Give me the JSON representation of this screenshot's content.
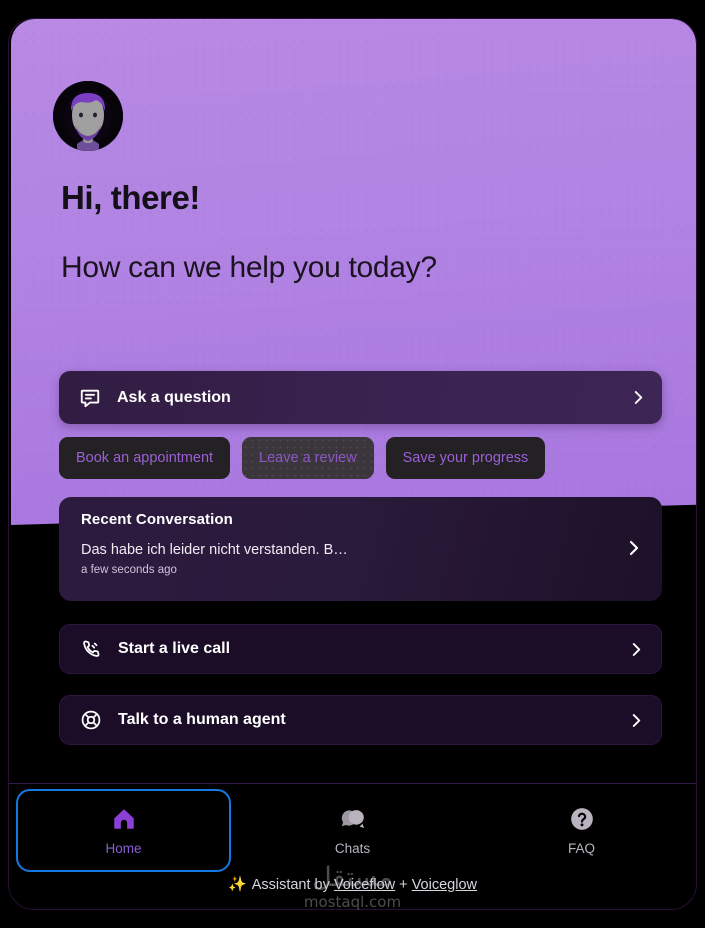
{
  "hero": {
    "avatar_alt": "assistant-avatar",
    "greeting": "Hi, there!",
    "subgreeting": "How can we help you today?"
  },
  "main_action": {
    "icon": "message-square-icon",
    "label": "Ask a question",
    "chevron": "chevron-right-icon"
  },
  "quick_replies": [
    {
      "label": "Book an appointment",
      "state": "default"
    },
    {
      "label": "Leave a review",
      "state": "hovered"
    },
    {
      "label": "Save your progress",
      "state": "default"
    }
  ],
  "recent_conversation": {
    "title": "Recent Conversation",
    "message": "Das habe ich leider nicht verstanden. B…",
    "timestamp": "a few seconds ago",
    "chevron": "chevron-right-icon"
  },
  "row_actions": [
    {
      "icon": "phone-call-icon",
      "label": "Start a live call",
      "chevron": "chevron-right-icon"
    },
    {
      "icon": "life-buoy-icon",
      "label": "Talk to a human agent",
      "chevron": "chevron-right-icon"
    }
  ],
  "nav": [
    {
      "icon": "home-icon",
      "label": "Home",
      "active": true,
      "focused": true
    },
    {
      "icon": "messages-icon",
      "label": "Chats",
      "active": false,
      "focused": false
    },
    {
      "icon": "question-circle-icon",
      "label": "FAQ",
      "active": false,
      "focused": false
    }
  ],
  "footer": {
    "spark_icon": "sparkles-icon",
    "prefix": "Assistant by ",
    "link1": "Voiceflow",
    "separator": " + ",
    "link2": "Voiceglow"
  },
  "watermark": {
    "arabic": "مستقل",
    "latin": "mostaql.com"
  },
  "colors": {
    "hero_purple": "#b183e3",
    "accent_purple": "#8b3fd4",
    "chip_bg": "#242124",
    "chip_text": "#9a5fd6",
    "focus_ring": "#1677df",
    "card_dark": "#2a1a3b",
    "row_dark": "#1b0d27",
    "spark_gold": "#e0b341"
  }
}
